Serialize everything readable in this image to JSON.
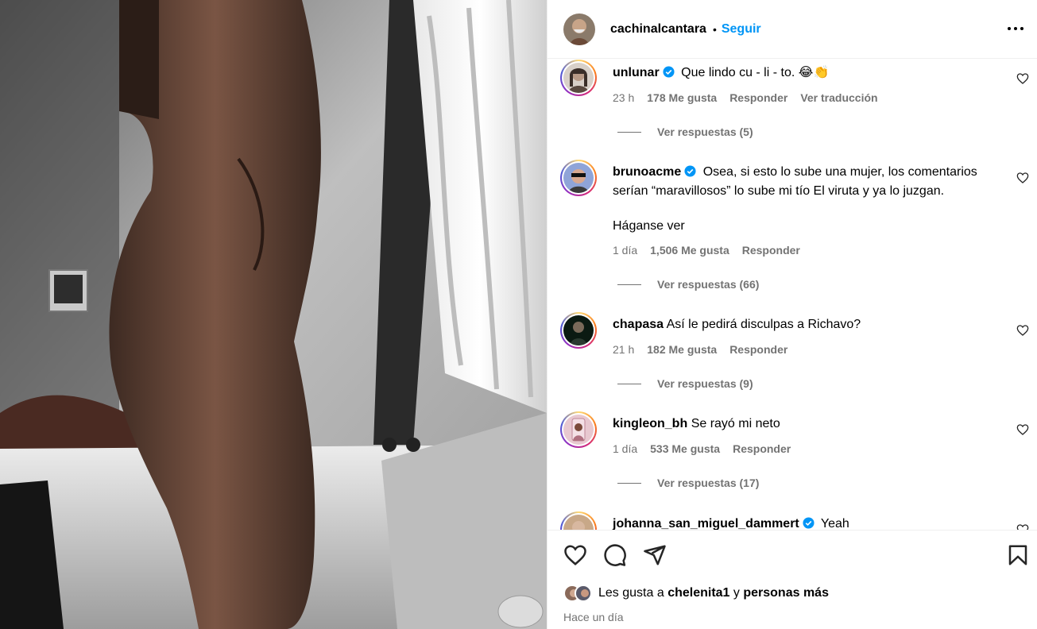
{
  "post": {
    "author": "cachinalcantara",
    "separator": "•",
    "follow_label": "Seguir",
    "timestamp": "Hace un día"
  },
  "comments": [
    {
      "user": "unlunar",
      "verified": true,
      "text": "Que lindo cu - li - to. 😂👏",
      "time": "23 h",
      "likes": "178 Me gusta",
      "reply": "Responder",
      "translate": "Ver traducción",
      "replies": "Ver respuestas (5)"
    },
    {
      "user": "brunoacme",
      "verified": true,
      "text": "Osea, si esto lo sube una mujer, los comentarios serían “maravillosos” lo sube mi tío El viruta y ya lo juzgan.",
      "text2": "Háganse ver",
      "time": "1 día",
      "likes": "1,506 Me gusta",
      "reply": "Responder",
      "replies": "Ver respuestas (66)"
    },
    {
      "user": "chapasa",
      "verified": false,
      "text": "Así le pedirá disculpas a Richavo?",
      "time": "21 h",
      "likes": "182 Me gusta",
      "reply": "Responder",
      "replies": "Ver respuestas (9)"
    },
    {
      "user": "kingleon_bh",
      "verified": false,
      "text": "Se rayó mi neto",
      "time": "1 día",
      "likes": "533 Me gusta",
      "reply": "Responder",
      "replies": "Ver respuestas (17)"
    },
    {
      "user": "johanna_san_miguel_dammert",
      "verified": true,
      "text": "Yeah"
    }
  ],
  "likes_summary": {
    "prefix": "Les gusta a",
    "user": "chelenita1",
    "conjunction": "y",
    "others": "personas más"
  },
  "colors": {
    "accent": "#0095f6",
    "secondary_text": "#737373",
    "verified": "#0095f6"
  },
  "icons": [
    "more-options-icon",
    "verified-badge-icon",
    "heart-icon",
    "comment-icon",
    "share-icon",
    "bookmark-icon"
  ]
}
